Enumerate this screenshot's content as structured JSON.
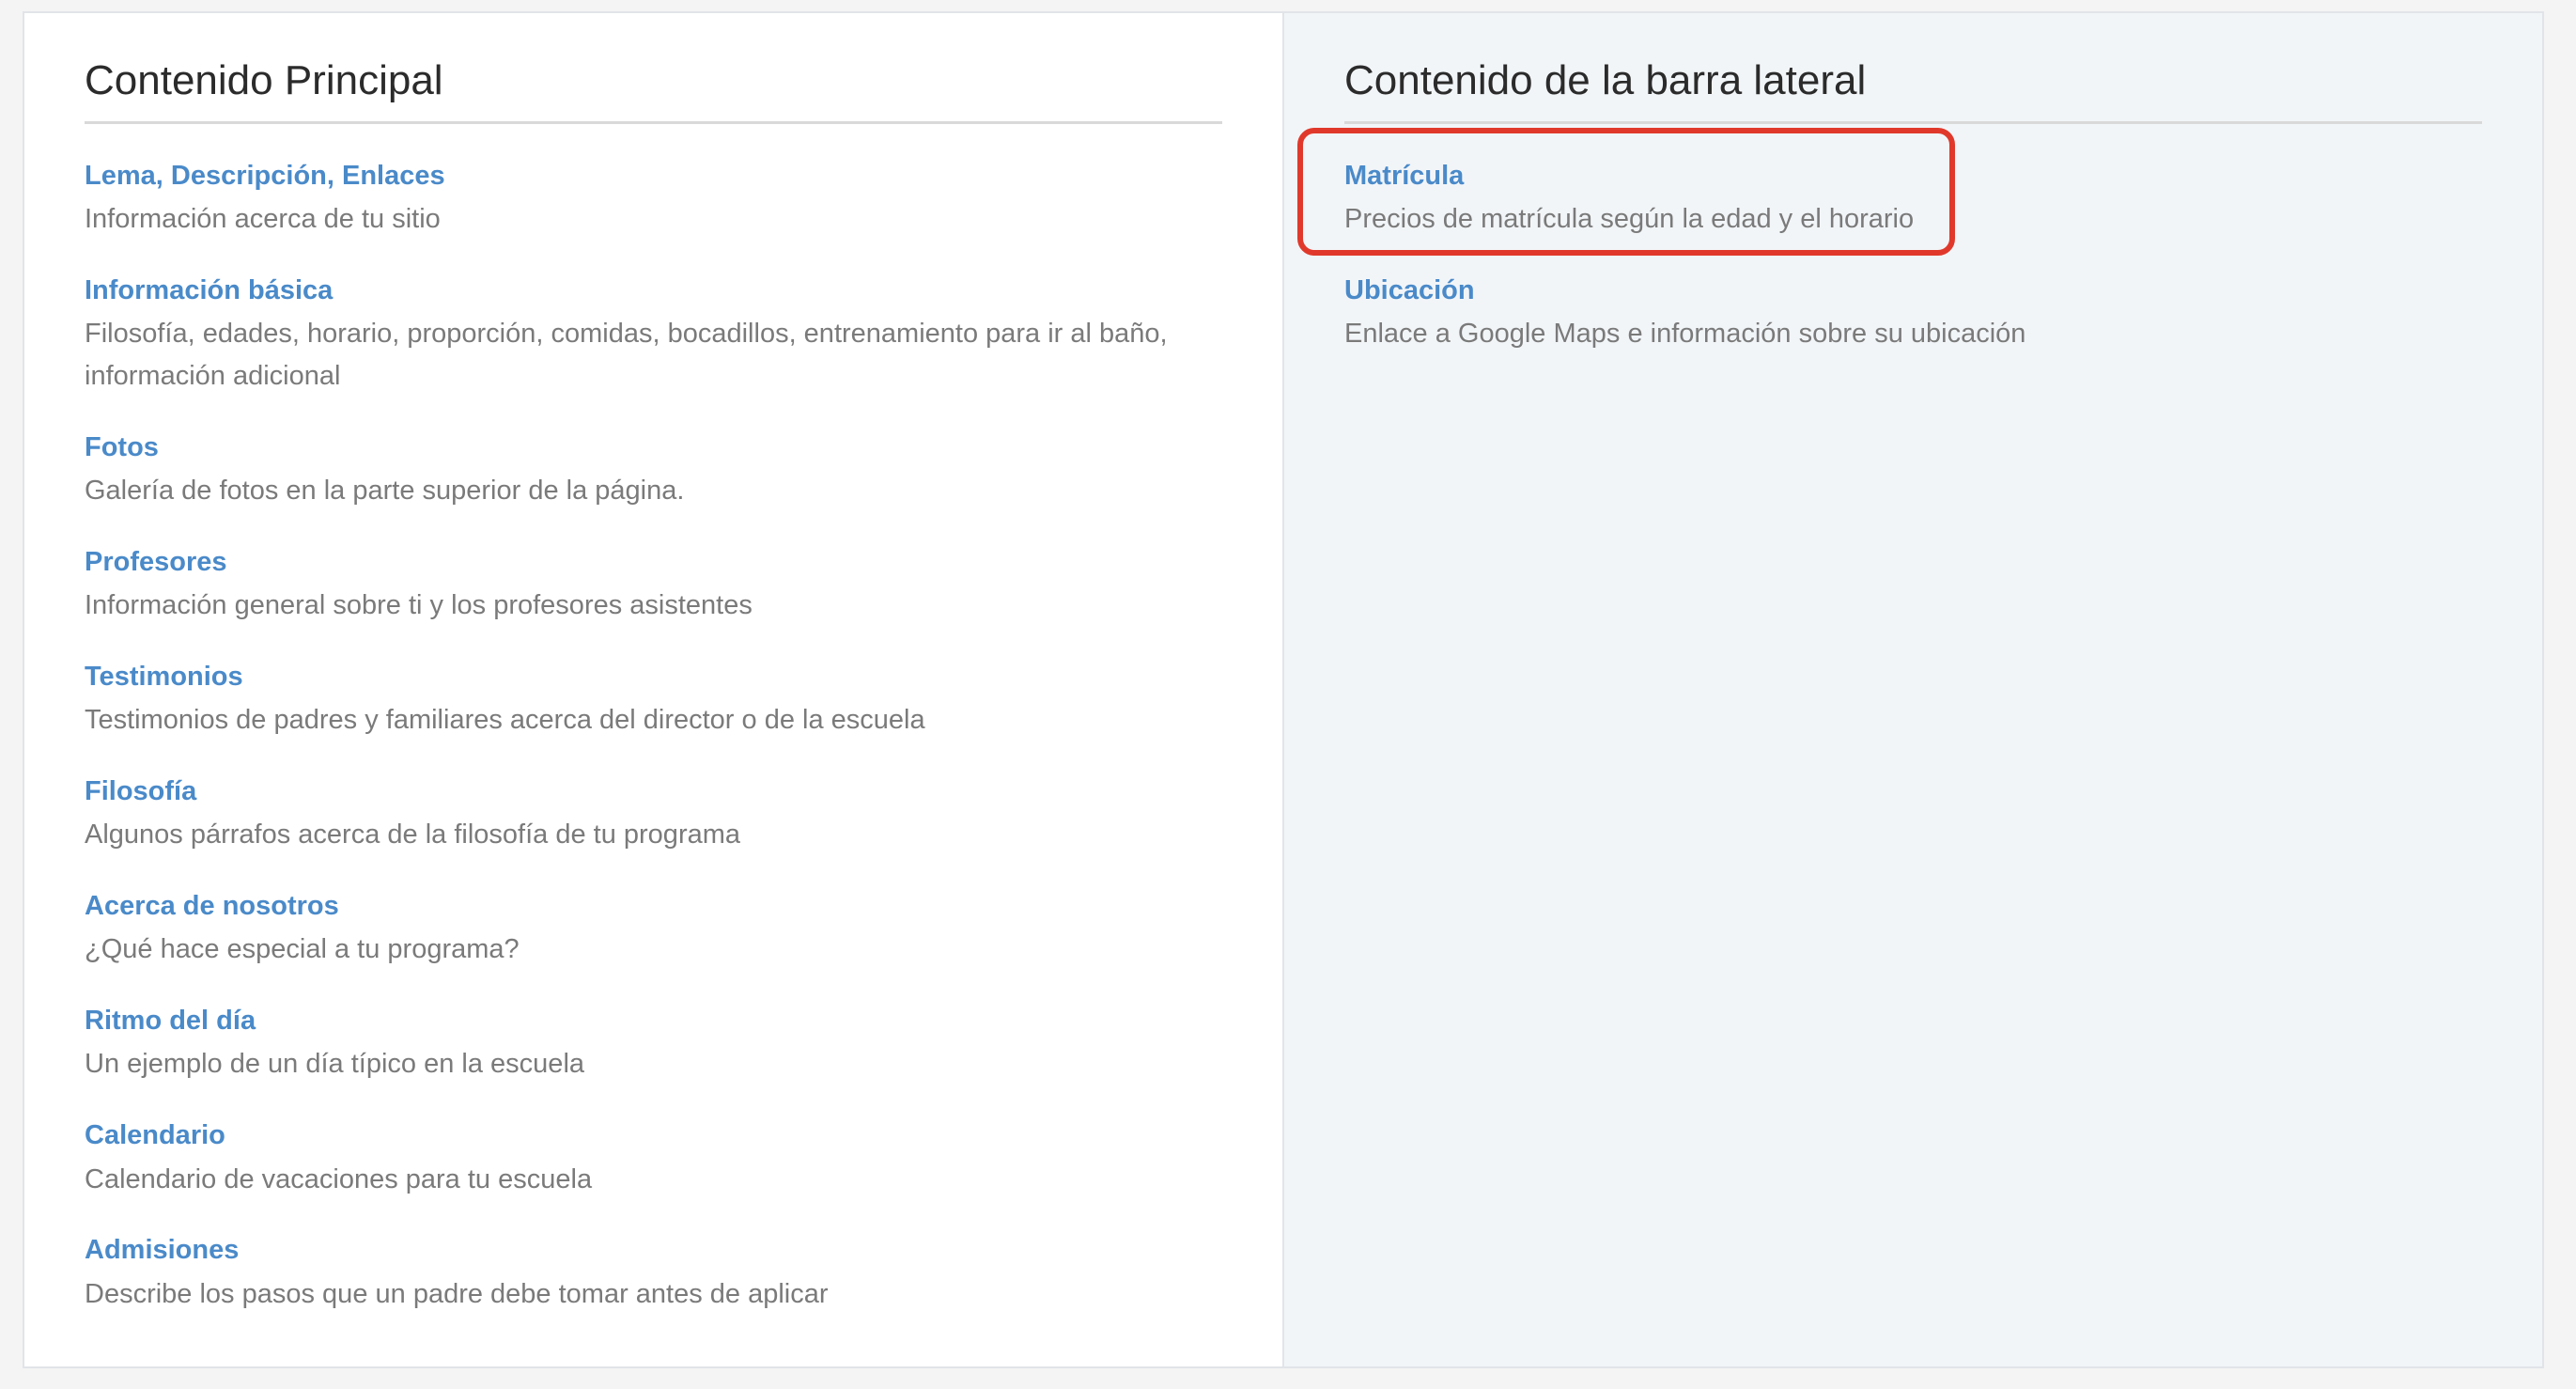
{
  "main": {
    "title": "Contenido Principal",
    "items": [
      {
        "label": "Lema, Descripción, Enlaces",
        "description": "Información acerca de tu sitio"
      },
      {
        "label": "Información básica",
        "description": "Filosofía, edades, horario, proporción, comidas, bocadillos, entrenamiento para ir al baño, información adicional"
      },
      {
        "label": "Fotos",
        "description": "Galería de fotos en la parte superior de la página."
      },
      {
        "label": "Profesores",
        "description": "Información general sobre ti y los profesores asistentes"
      },
      {
        "label": "Testimonios",
        "description": "Testimonios de padres y familiares acerca del director o de la escuela"
      },
      {
        "label": "Filosofía",
        "description": "Algunos párrafos acerca de la filosofía de tu programa"
      },
      {
        "label": "Acerca de nosotros",
        "description": "¿Qué hace especial a tu programa?"
      },
      {
        "label": "Ritmo del día",
        "description": "Un ejemplo de un día típico en la escuela"
      },
      {
        "label": "Calendario",
        "description": "Calendario de vacaciones para tu escuela"
      },
      {
        "label": "Admisiones",
        "description": "Describe los pasos que un padre debe tomar antes de aplicar"
      }
    ]
  },
  "sidebar": {
    "title": "Contenido de la barra lateral",
    "items": [
      {
        "label": "Matrícula",
        "description": "Precios de matrícula según la edad y el horario"
      },
      {
        "label": "Ubicación",
        "description": "Enlace a Google Maps e información sobre su ubicación"
      }
    ]
  },
  "colors": {
    "link": "#4a8ac9",
    "description": "#7a7a7a",
    "highlight": "#e0392b",
    "sidebar_bg": "#f2f5f8"
  }
}
